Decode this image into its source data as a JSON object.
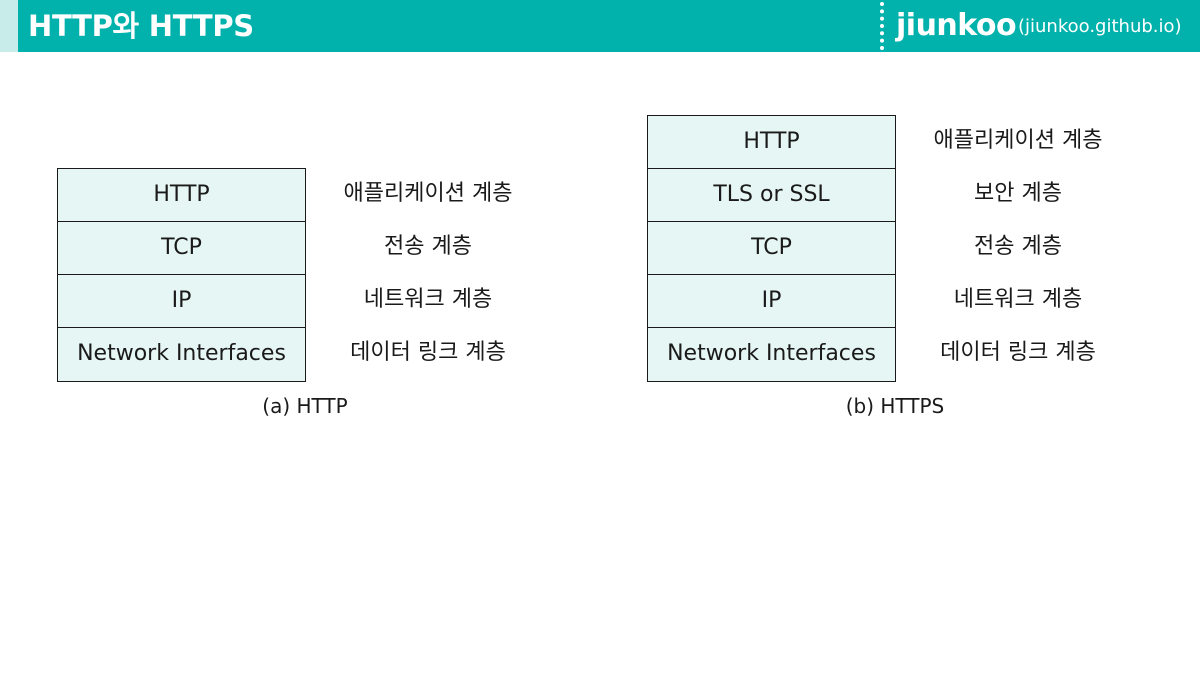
{
  "header": {
    "title": "HTTP와 HTTPS",
    "brand": "jiunkoo",
    "brand_url": "(jiunkoo.github.io)",
    "background_color": "#00b1ac",
    "accent_color": "#c7ece9"
  },
  "http_diagram": {
    "caption": "(a) HTTP",
    "layers": [
      "HTTP",
      "TCP",
      "IP",
      "Network Interfaces"
    ],
    "layer_names": [
      "애플리케이션 계층",
      "전송 계층",
      "네트워크 계층",
      "데이터 링크 계층"
    ]
  },
  "https_diagram": {
    "caption": "(b) HTTPS",
    "layers": [
      "HTTP",
      "TLS or SSL",
      "TCP",
      "IP",
      "Network Interfaces"
    ],
    "layer_names": [
      "애플리케이션 계층",
      "보안 계층",
      "전송 계층",
      "네트워크 계층",
      "데이터 링크 계층"
    ]
  },
  "colors": {
    "box_fill": "#e6f6f4",
    "box_border": "#1a1a1a"
  }
}
